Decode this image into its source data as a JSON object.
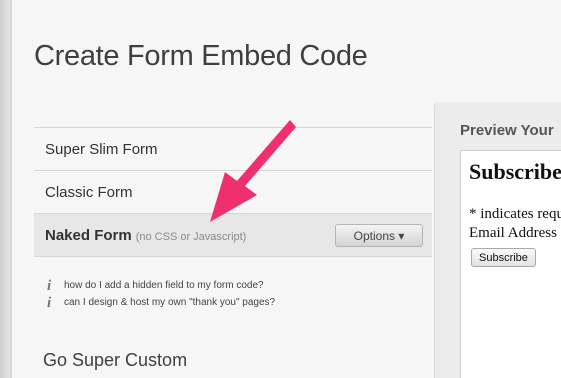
{
  "page": {
    "title": "Create Form Embed Code"
  },
  "forms": [
    {
      "label": "Super Slim Form",
      "note": ""
    },
    {
      "label": "Classic Form",
      "note": ""
    },
    {
      "label": "Naked Form",
      "note": "(no CSS or Javascript)",
      "options_label": "Options ▾"
    }
  ],
  "help_links": [
    {
      "icon": "info-icon",
      "text": "how do I add a hidden field to my form code?"
    },
    {
      "icon": "info-icon",
      "text": "can I design & host my own \"thank you\" pages?"
    }
  ],
  "custom_section": {
    "title": "Go Super Custom"
  },
  "preview": {
    "title": "Preview Your",
    "heading": "Subscribe",
    "required_note": "* indicates requ",
    "email_label": "Email Address",
    "subscribe_label": "Subscribe"
  },
  "colors": {
    "arrow": "#f0306e",
    "selected_row": "#e7e7e7"
  }
}
